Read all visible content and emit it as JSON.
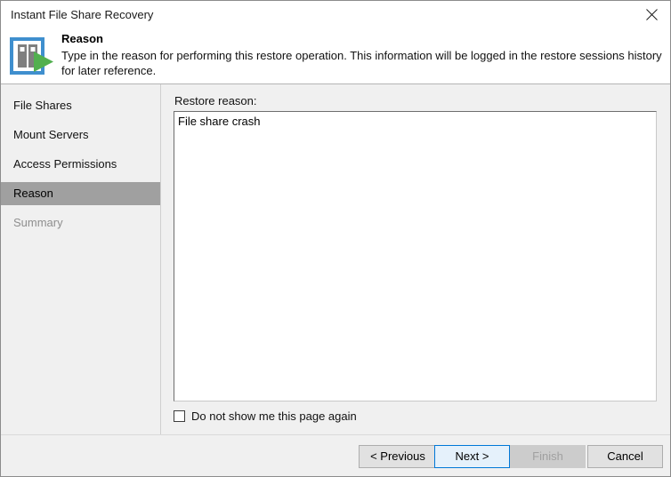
{
  "window": {
    "title": "Instant File Share Recovery",
    "close_icon": "close-icon"
  },
  "header": {
    "icon": "file-share-restore-icon",
    "title": "Reason",
    "description": "Type in the reason for performing this restore operation. This information will be logged in the restore sessions history for later reference."
  },
  "sidebar": {
    "items": [
      {
        "label": "File Shares",
        "state": "normal"
      },
      {
        "label": "Mount Servers",
        "state": "normal"
      },
      {
        "label": "Access Permissions",
        "state": "normal"
      },
      {
        "label": "Reason",
        "state": "selected"
      },
      {
        "label": "Summary",
        "state": "disabled"
      }
    ]
  },
  "main": {
    "reason_label": "Restore reason:",
    "reason_value": "File share crash",
    "reason_placeholder": "",
    "dont_show_label": "Do not show me this page again",
    "dont_show_checked": false
  },
  "footer": {
    "buttons": [
      {
        "label": "< Previous",
        "state": "normal"
      },
      {
        "label": "Next >",
        "state": "default"
      },
      {
        "label": "Finish",
        "state": "disabled"
      },
      {
        "label": "Cancel",
        "state": "normal"
      }
    ]
  },
  "colors": {
    "accent": "#0078d7",
    "selection": "#a0a0a0",
    "icon_blue": "#3f8fce",
    "icon_green": "#52b04f",
    "icon_gray": "#7f7f7f",
    "background": "#f0f0f0"
  }
}
